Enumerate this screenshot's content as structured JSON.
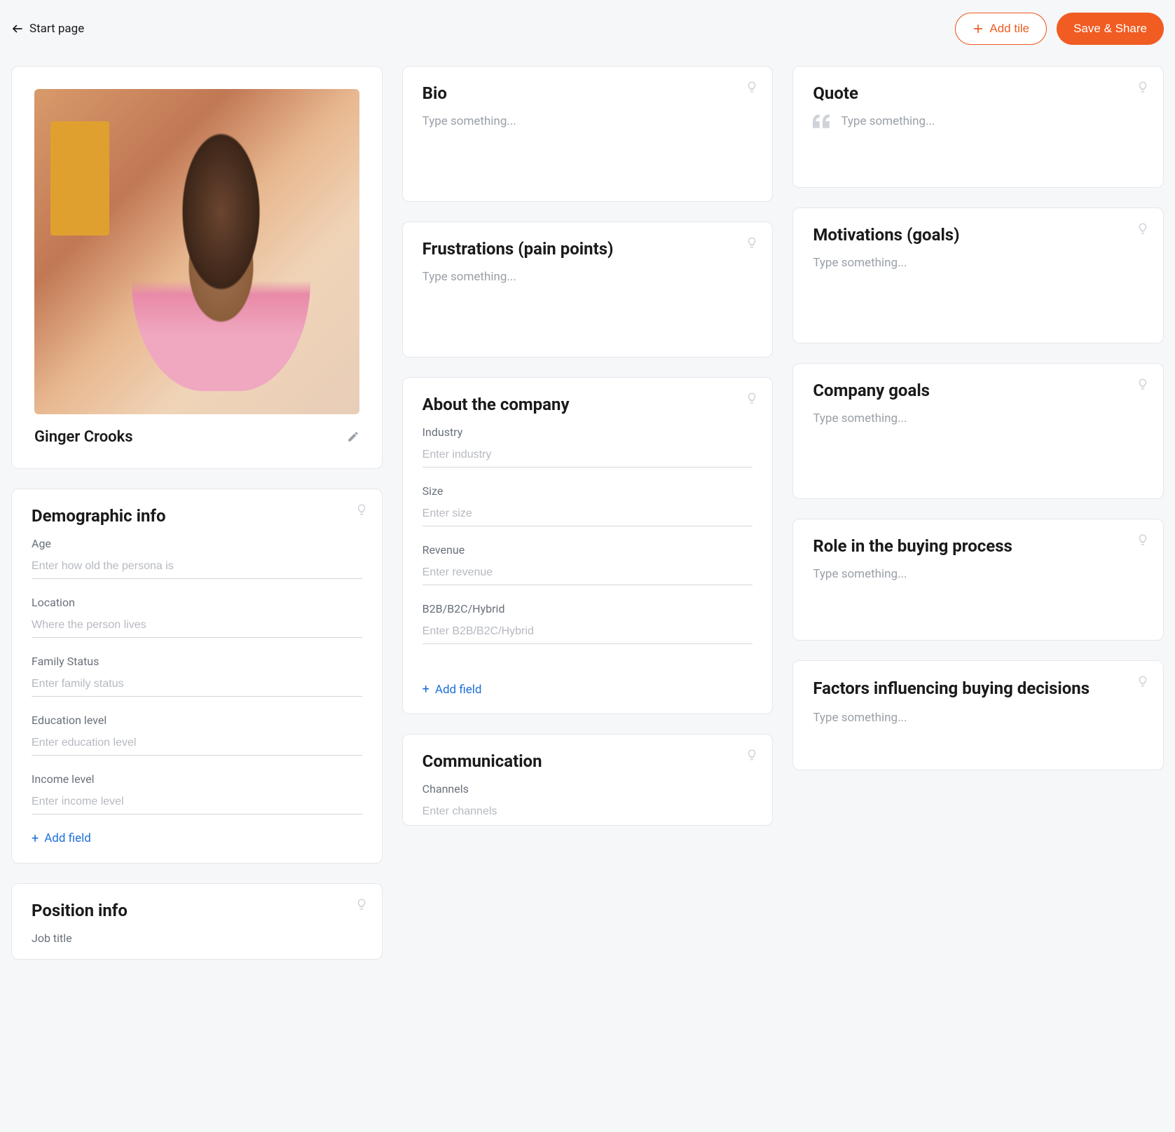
{
  "header": {
    "back_label": "Start page",
    "add_tile_label": "Add tile",
    "save_label": "Save & Share"
  },
  "profile": {
    "name": "Ginger Crooks"
  },
  "tiles": {
    "bio": {
      "title": "Bio",
      "placeholder": "Type something..."
    },
    "quote": {
      "title": "Quote",
      "placeholder": "Type something..."
    },
    "frustrations": {
      "title": "Frustrations (pain points)",
      "placeholder": "Type something..."
    },
    "motivations": {
      "title": "Motivations (goals)",
      "placeholder": "Type something..."
    },
    "demographic": {
      "title": "Demographic info",
      "add_field_label": "Add field",
      "fields": {
        "age": {
          "label": "Age",
          "placeholder": "Enter how old the persona is"
        },
        "location": {
          "label": "Location",
          "placeholder": "Where the person lives"
        },
        "family": {
          "label": "Family Status",
          "placeholder": "Enter family status"
        },
        "education": {
          "label": "Education level",
          "placeholder": "Enter education level"
        },
        "income": {
          "label": "Income level",
          "placeholder": "Enter income level"
        }
      }
    },
    "about_company": {
      "title": "About the company",
      "add_field_label": "Add field",
      "fields": {
        "industry": {
          "label": "Industry",
          "placeholder": "Enter industry"
        },
        "size": {
          "label": "Size",
          "placeholder": "Enter size"
        },
        "revenue": {
          "label": "Revenue",
          "placeholder": "Enter revenue"
        },
        "model": {
          "label": "B2B/B2C/Hybrid",
          "placeholder": "Enter B2B/B2C/Hybrid"
        }
      }
    },
    "company_goals": {
      "title": "Company goals",
      "placeholder": "Type something..."
    },
    "role_buying": {
      "title": "Role in the buying process",
      "placeholder": "Type something..."
    },
    "factors": {
      "title": "Factors influencing buying decisions",
      "placeholder": "Type something..."
    },
    "position": {
      "title": "Position info",
      "fields": {
        "job_title": {
          "label": "Job title"
        }
      }
    },
    "communication": {
      "title": "Communication",
      "fields": {
        "channels": {
          "label": "Channels",
          "placeholder": "Enter channels"
        }
      }
    }
  }
}
